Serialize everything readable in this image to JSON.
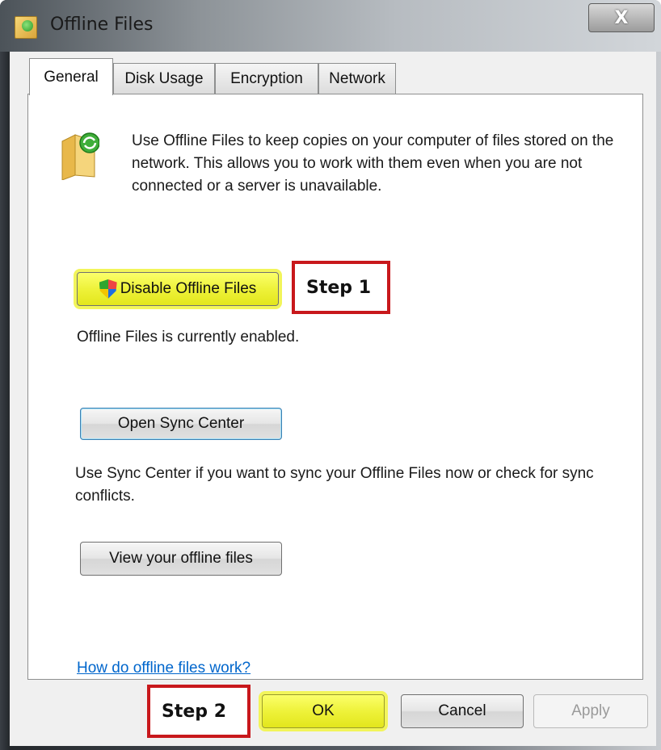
{
  "window": {
    "title": "Offline Files",
    "close_label": "X"
  },
  "tabs": [
    {
      "label": "General",
      "active": true
    },
    {
      "label": "Disk Usage",
      "active": false
    },
    {
      "label": "Encryption",
      "active": false
    },
    {
      "label": "Network",
      "active": false
    }
  ],
  "general": {
    "description": "Use Offline Files to keep copies on your computer of files stored on the network.  This allows you to work with them even when you are not connected or a server is unavailable.",
    "disable_button": "Disable Offline Files",
    "step1_label": "Step 1",
    "status_text": "Offline Files is currently enabled.",
    "sync_button": "Open Sync Center",
    "sync_description": "Use Sync Center if you want to sync your Offline Files now or check for sync conflicts.",
    "view_button": "View your offline files",
    "help_link": "How do offline files work?"
  },
  "footer": {
    "step2_label": "Step 2",
    "ok_button": "OK",
    "cancel_button": "Cancel",
    "apply_button": "Apply"
  },
  "colors": {
    "highlight": "#f2f55a",
    "step_border": "#c8181c",
    "link": "#0066cc"
  },
  "icons": {
    "title": "offline-files-icon",
    "folder": "folder-sync-icon",
    "shield": "uac-shield-icon"
  }
}
